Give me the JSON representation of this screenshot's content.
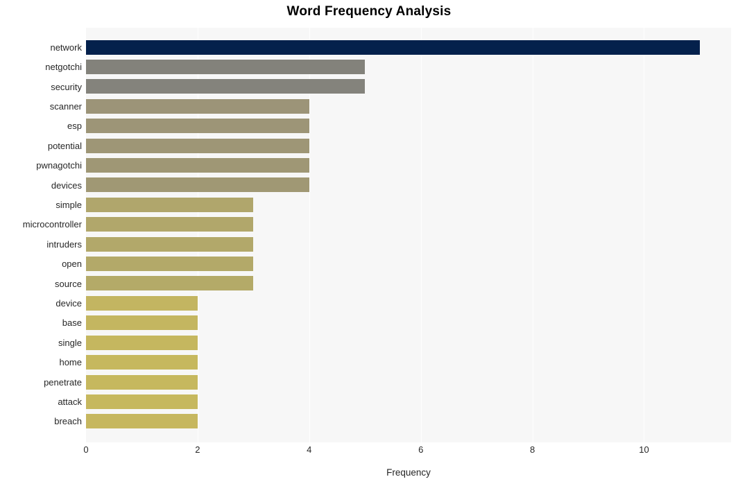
{
  "chart_data": {
    "type": "bar",
    "orientation": "horizontal",
    "title": "Word Frequency Analysis",
    "xlabel": "Frequency",
    "ylabel": "",
    "categories": [
      "network",
      "netgotchi",
      "security",
      "scanner",
      "esp",
      "potential",
      "pwnagotchi",
      "devices",
      "simple",
      "microcontroller",
      "intruders",
      "open",
      "source",
      "device",
      "base",
      "single",
      "home",
      "penetrate",
      "attack",
      "breach"
    ],
    "values": [
      11,
      5,
      5,
      4,
      4,
      4,
      4,
      4,
      3,
      3,
      3,
      3,
      3,
      2,
      2,
      2,
      2,
      2,
      2,
      2
    ],
    "bar_colors": [
      "#04214c",
      "#83827b",
      "#84837c",
      "#9c9478",
      "#9d9577",
      "#9e9676",
      "#9f9775",
      "#a09874",
      "#b0a66c",
      "#b1a76b",
      "#b2a86a",
      "#b3a969",
      "#b4aa68",
      "#c3b561",
      "#c4b660",
      "#c5b75f",
      "#c6b85e",
      "#c6b85e",
      "#c6b85e",
      "#c6b75f"
    ],
    "xlim": [
      0,
      11.56
    ],
    "xticks": [
      0,
      2,
      4,
      6,
      8,
      10
    ],
    "xtick_labels": [
      "0",
      "2",
      "4",
      "6",
      "8",
      "10"
    ],
    "gridlines": [
      2,
      4,
      6,
      8,
      10
    ],
    "grid": true,
    "legend": null,
    "plot_background": "#f7f7f7",
    "figure_background": "#ffffff",
    "title_color": "#000000",
    "tick_color": "#262626"
  }
}
